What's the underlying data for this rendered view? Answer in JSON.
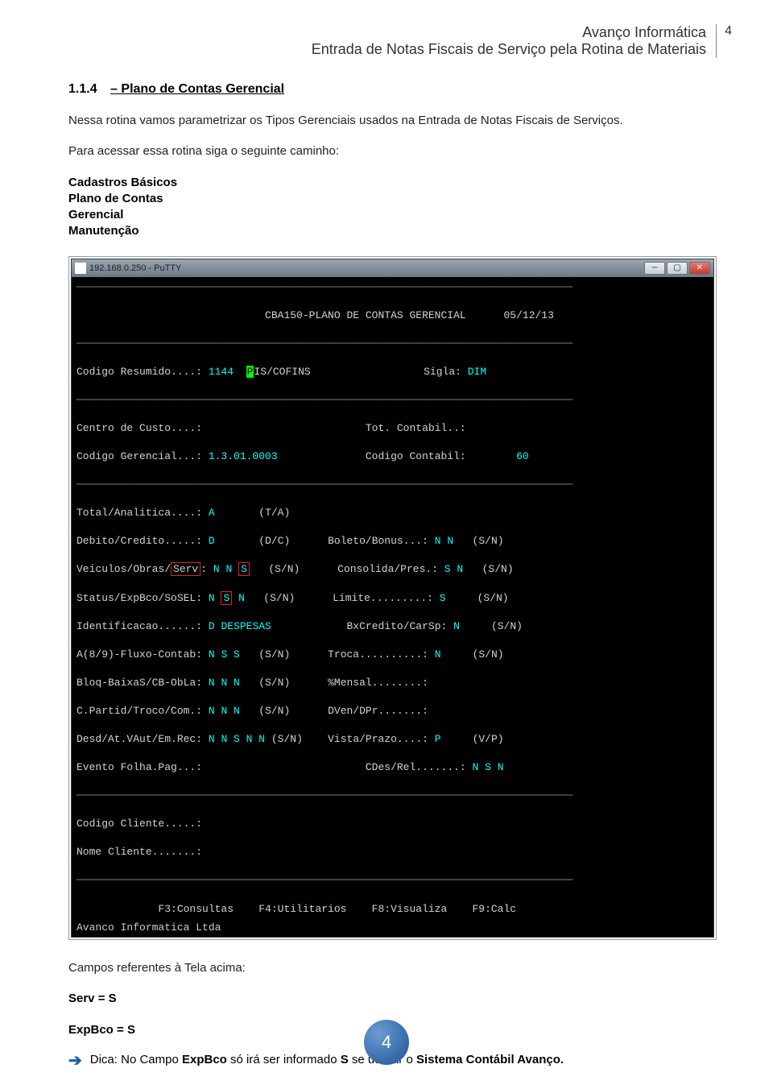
{
  "header": {
    "line1": "Avanço Informática",
    "line2": "Entrada de Notas Fiscais de Serviço pela Rotina de Materiais",
    "page_number": "4"
  },
  "section": {
    "number": "1.1.4",
    "title": "– Plano de Contas Gerencial"
  },
  "body": {
    "intro": "Nessa rotina vamos parametrizar os Tipos Gerenciais usados na Entrada de Notas Fiscais de Serviços.",
    "path_intro": "Para acessar essa rotina siga o seguinte caminho:",
    "path_items": [
      "Cadastros Básicos",
      "Plano de Contas",
      "Gerencial",
      "Manutenção"
    ],
    "after_shot": "Campos referentes à Tela acima:",
    "fields": [
      "Serv = S",
      "ExpBco = S"
    ],
    "tip_prefix": "Dica: No Campo ",
    "tip_bold1": "ExpBco",
    "tip_mid": " só irá ser informado ",
    "tip_bold2": "S",
    "tip_mid2": " se utilizar o ",
    "tip_bold3": "Sistema Contábil Avanço.",
    "footer_page": "4"
  },
  "terminal": {
    "putty_title": "192.168.0.250 - PuTTY",
    "header_title": "CBA150-PLANO DE CONTAS GERENCIAL",
    "header_date": "05/12/13",
    "codigo_resumido_label": "Codigo Resumido....: ",
    "codigo_resumido_val": "1144",
    "piscofins_prefix": "P",
    "piscofins_rest": "IS/COFINS",
    "sigla_label": "Sigla:",
    "sigla_val": "DIM",
    "centro_custo": "Centro de Custo....:",
    "tot_contabil": "Tot. Contabil..:",
    "codigo_gerencial_label": "Codigo Gerencial...: ",
    "codigo_gerencial_val": "1.3.01.0003",
    "codigo_contabil_label": "Codigo Contabil:",
    "codigo_contabil_val": "60",
    "rows_left": [
      {
        "label": "Total/Analitica....:",
        "val": "A",
        "suf": "(T/A)"
      },
      {
        "label": "Debito/Credito.....:",
        "val": "D",
        "suf": "(D/C)"
      },
      {
        "label": "Veiculos/Obras/",
        "serv": "Serv",
        "sep": ": ",
        "v1": "N",
        "v2": "N",
        "v3": "S",
        "suf": "(S/N)"
      },
      {
        "label": "Status/ExpBco/SoSEL: ",
        "v1": "N",
        "v2": "S",
        "v3": "N",
        "suf": "(S/N)"
      },
      {
        "label": "Identificacao......:",
        "val": "D DESPESAS",
        "suf": ""
      },
      {
        "label": "A(8/9)-Fluxo-Contab:",
        "val": "N S S",
        "suf": "(S/N)"
      },
      {
        "label": "Bloq-BaixaS/CB-ObLa:",
        "val": "N N N",
        "suf": "(S/N)"
      },
      {
        "label": "C.Partid/Troco/Com.:",
        "val": "N N N",
        "suf": "(S/N)"
      },
      {
        "label": "Desd/At.VAut/Em.Rec:",
        "val": "N N S N N",
        "suf": "(S/N)"
      },
      {
        "label": "Evento Folha.Pag...:",
        "val": "",
        "suf": ""
      }
    ],
    "rows_right": [
      {
        "label": "Boleto/Bonus...:",
        "val": "N N",
        "suf": "(S/N)"
      },
      {
        "label": "Consolida/Pres.:",
        "val": "S N",
        "suf": "(S/N)"
      },
      {
        "label": "Limite.........:",
        "val": "S",
        "suf": "(S/N)"
      },
      {
        "label": "BxCredito/CarSp:",
        "val": "N",
        "suf": "(S/N)"
      },
      {
        "label": "Troca..........:",
        "val": "N",
        "suf": "(S/N)"
      },
      {
        "label": "%Mensal........:",
        "val": "",
        "suf": ""
      },
      {
        "label": "DVen/DPr.......:",
        "val": "",
        "suf": ""
      },
      {
        "label": "Vista/Prazo....:",
        "val": "P",
        "suf": "(V/P)"
      },
      {
        "label": "CDes/Rel.......:",
        "val": "N S N",
        "suf": ""
      }
    ],
    "codigo_cliente": "Codigo Cliente.....:",
    "nome_cliente": "Nome Cliente.......:",
    "helpbar": "             F3:Consultas    F4:Utilitarios    F8:Visualiza    F9:Calc",
    "footer": "Avanco Informatica Ltda"
  }
}
